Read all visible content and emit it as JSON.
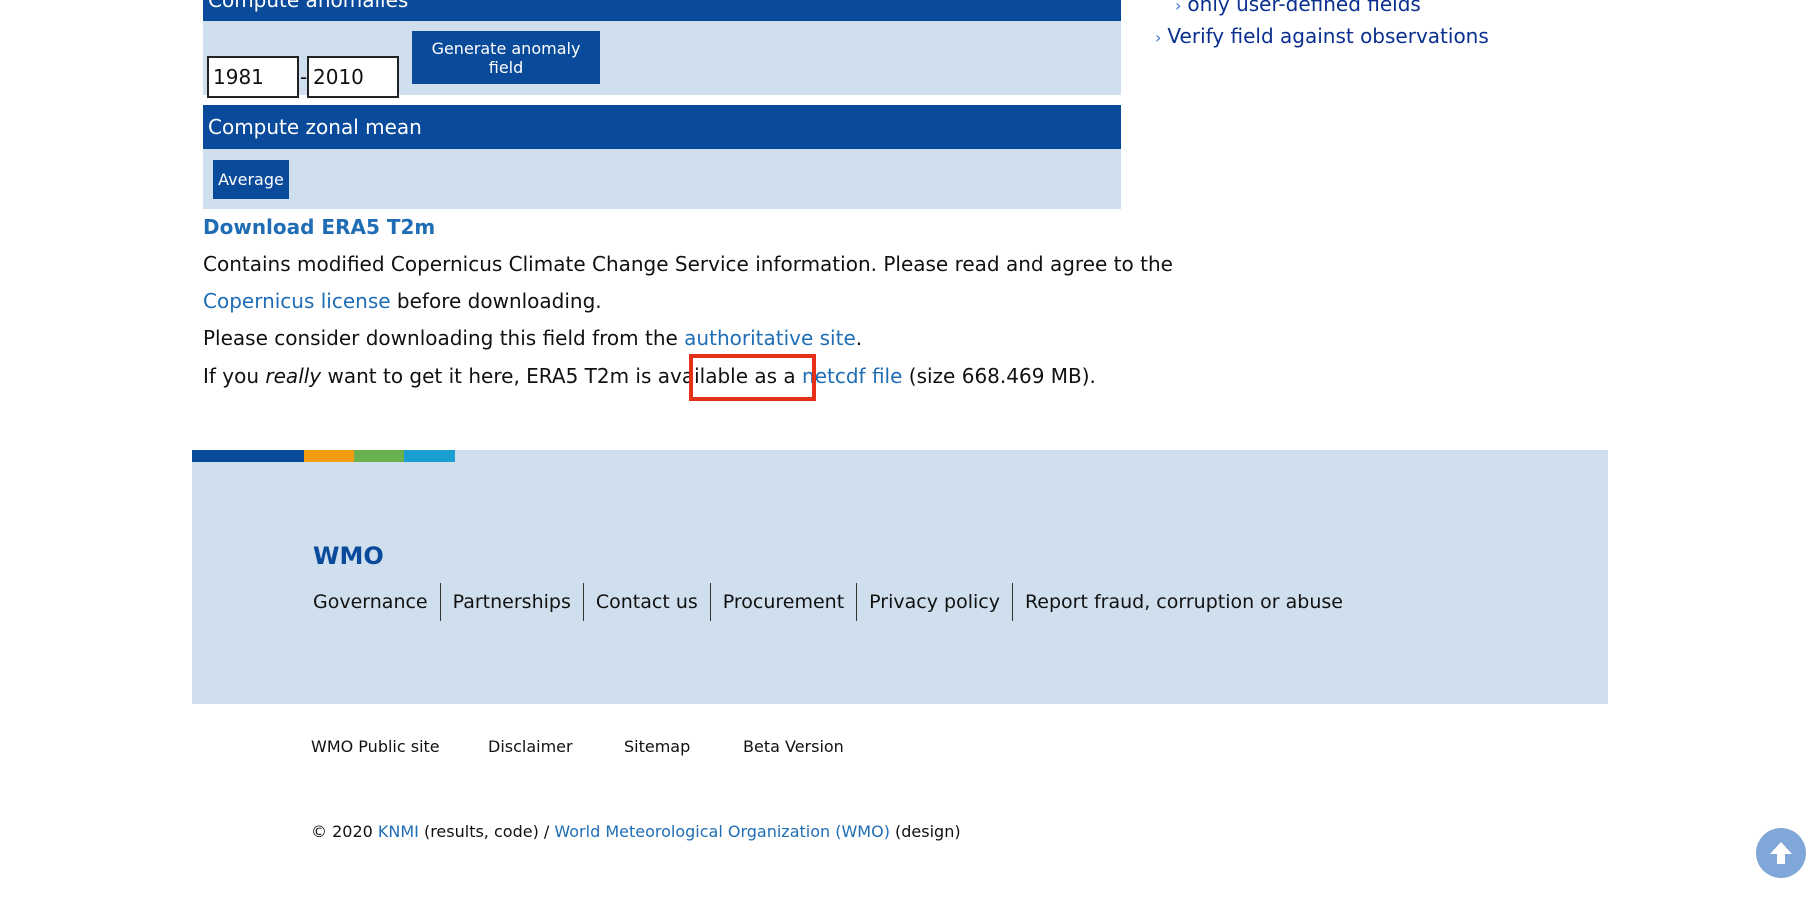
{
  "anomalies": {
    "title": "Compute anomalies",
    "year_from": "1981",
    "year_separator": "-",
    "year_to": "2010",
    "generate_label": "Generate anomaly field"
  },
  "zonal": {
    "title": "Compute zonal mean",
    "average_label": "Average"
  },
  "download": {
    "title": "Download ERA5 T2m",
    "line1": "Contains modified Copernicus Climate Change Service information. Please read and agree to the",
    "license_link": "Copernicus license",
    "line2_rest": " before downloading.",
    "line3_pre": "Please consider downloading this field from the ",
    "authoritative_link": "authoritative site",
    "line3_post": ".",
    "line4_pre": "If you ",
    "line4_em": "really",
    "line4_mid": " want to get it here, ERA5 T2m is available as a ",
    "netcdf_link": "netcdf file",
    "line4_post": " (size 668.469 MB)."
  },
  "sidebar": {
    "item_partial": "only user-defined fields",
    "verify": "Verify field against observations"
  },
  "footer": {
    "brand": "WMO",
    "links": [
      "Governance",
      "Partnerships",
      "Contact us",
      "Procurement",
      "Privacy policy",
      "Report fraud, corruption or abuse"
    ],
    "sub_links": [
      "WMO Public site",
      "Disclaimer",
      "Sitemap",
      "Beta Version"
    ],
    "copyright_pre": "© 2020 ",
    "knmi": "KNMI",
    "copyright_mid": " (results, code) / ",
    "wmo_full": "World Meteorological Organization (WMO)",
    "copyright_post": " (design)"
  },
  "colors": {
    "primary": "#0a4a9b",
    "panel": "#cfdfee",
    "link": "#1f6db5",
    "strip": [
      "#0a4a9b",
      "#f39c12",
      "#6ab04c",
      "#1aa0d0"
    ],
    "highlight": "#e53018"
  },
  "icons": {
    "chevron": "chevron-right-icon",
    "scroll_top": "arrow-up-circle-icon"
  }
}
